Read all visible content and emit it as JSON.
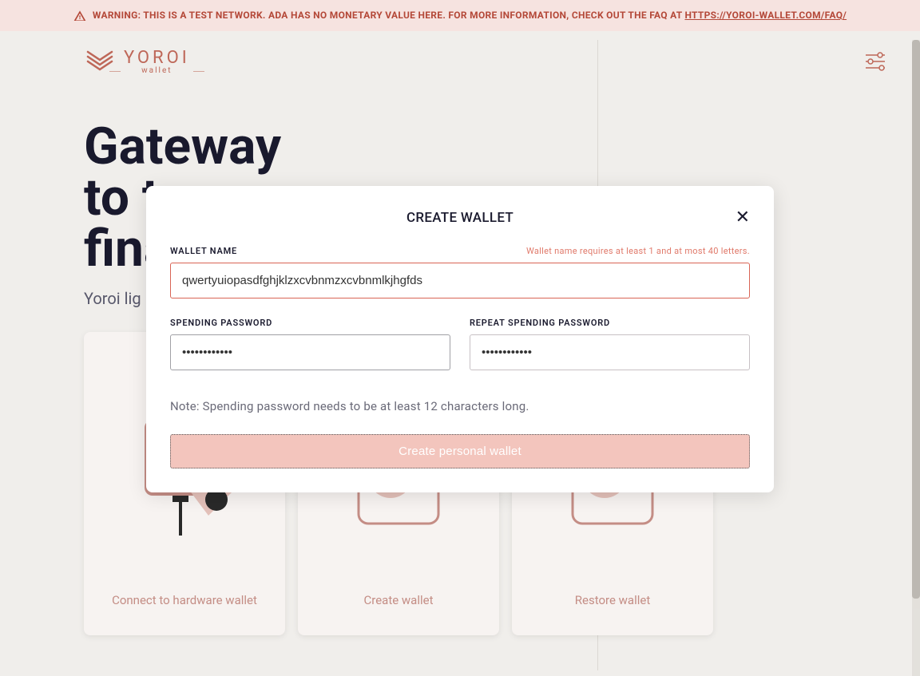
{
  "warning": {
    "prefix": "WARNING: THIS IS A TEST NETWORK. ADA HAS NO MONETARY VALUE HERE. FOR MORE INFORMATION, CHECK OUT THE FAQ AT ",
    "link_text": "HTTPS://YOROI-WALLET.COM/FAQ/"
  },
  "brand": {
    "name": "YOROI",
    "sub": "wallet"
  },
  "hero": {
    "title_line1": "Gateway",
    "title_line2": "to t",
    "title_line3": "fina",
    "subtitle": "Yoroi lig"
  },
  "cards": {
    "hw": "Connect to hardware wallet",
    "create": "Create wallet",
    "restore": "Restore wallet"
  },
  "modal": {
    "title": "CREATE WALLET",
    "wallet_name_label": "WALLET NAME",
    "wallet_name_error": "Wallet name requires at least 1 and at most 40 letters.",
    "wallet_name_value": "qwertyuiopasdfghjklzxcvbnmzxcvbnmlkjhgfds",
    "spending_label": "SPENDING PASSWORD",
    "spending_value": "••••••••••••",
    "repeat_label": "REPEAT SPENDING PASSWORD",
    "repeat_value": "••••••••••••",
    "note": "Note: Spending password needs to be at least 12 characters long.",
    "submit": "Create personal wallet"
  }
}
